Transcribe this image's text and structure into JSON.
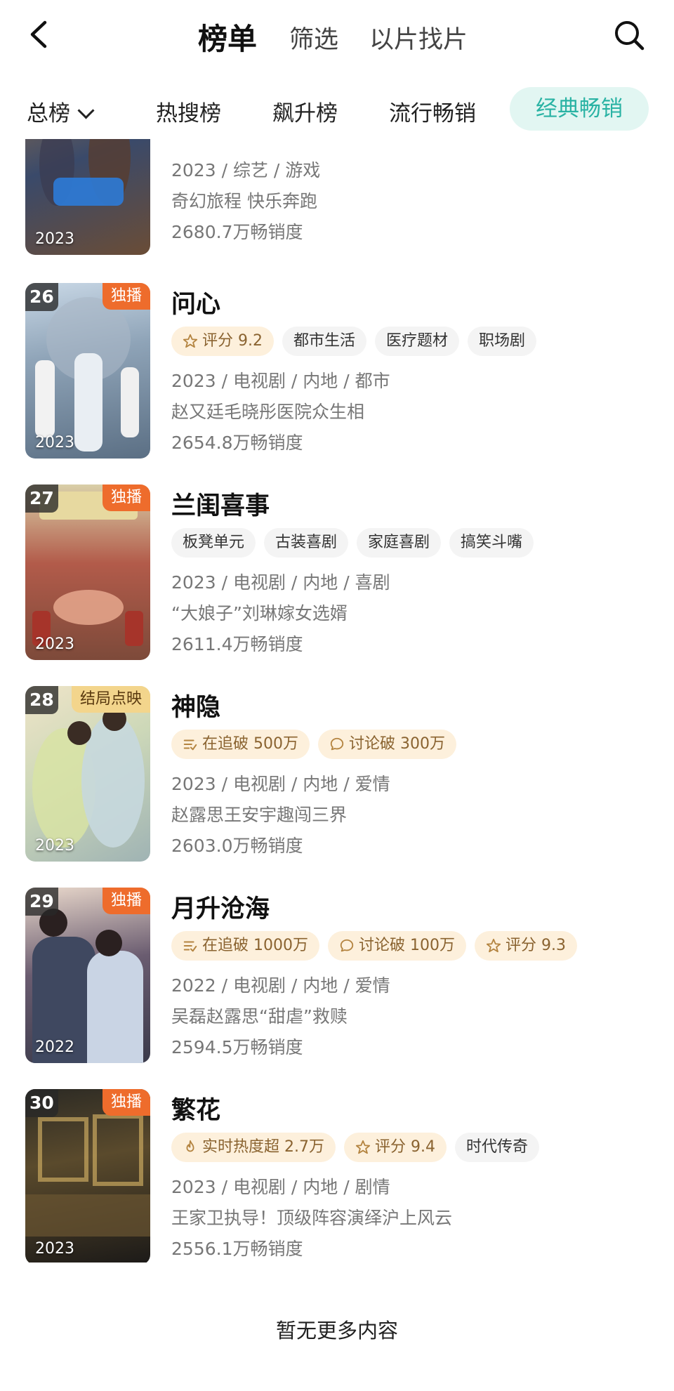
{
  "header": {
    "title": "榜单",
    "tabs": [
      "筛选",
      "以片找片"
    ]
  },
  "subtabs": {
    "dropdown": "总榜",
    "items": [
      "热搜榜",
      "飙升榜",
      "流行畅销"
    ],
    "active": "经典畅销"
  },
  "colors": {
    "accent": "#2ab3a4",
    "accent_bg": "#e2f6f2",
    "exclusive_badge": "#ee6c2c",
    "warm_tag_bg": "#fdf0dc"
  },
  "items": [
    {
      "year": "2023",
      "meta": "2023 / 综艺 / 游戏",
      "desc": "奇幻旅程 快乐奔跑",
      "heat": "2680.7万畅销度"
    },
    {
      "rank": "26",
      "badge": "独播",
      "name": "问心",
      "year": "2023",
      "tags": [
        {
          "icon": "star-icon",
          "text": "评分 9.2",
          "warm": true
        },
        {
          "text": "都市生活"
        },
        {
          "text": "医疗题材"
        },
        {
          "text": "职场剧"
        }
      ],
      "meta": "2023 / 电视剧 / 内地 / 都市",
      "desc": "赵又廷毛晓彤医院众生相",
      "heat": "2654.8万畅销度"
    },
    {
      "rank": "27",
      "badge": "独播",
      "name": "兰闺喜事",
      "year": "2023",
      "tags": [
        {
          "text": "板凳单元"
        },
        {
          "text": "古装喜剧"
        },
        {
          "text": "家庭喜剧"
        },
        {
          "text": "搞笑斗嘴"
        }
      ],
      "meta": "2023 / 电视剧 / 内地 / 喜剧",
      "desc": "“大娘子”刘琳嫁女选婿",
      "heat": "2611.4万畅销度"
    },
    {
      "rank": "28",
      "badge": "结局点映",
      "name": "神隐",
      "year": "2023",
      "tags": [
        {
          "icon": "list-icon",
          "text": "在追破 500万",
          "warm": true
        },
        {
          "icon": "comment-icon",
          "text": "讨论破 300万",
          "warm": true
        }
      ],
      "meta": "2023 / 电视剧 / 内地 / 爱情",
      "desc": "赵露思王安宇趣闯三界",
      "heat": "2603.0万畅销度"
    },
    {
      "rank": "29",
      "badge": "独播",
      "name": "月升沧海",
      "year": "2022",
      "tags": [
        {
          "icon": "list-icon",
          "text": "在追破 1000万",
          "warm": true
        },
        {
          "icon": "comment-icon",
          "text": "讨论破 100万",
          "warm": true
        },
        {
          "icon": "star-icon",
          "text": "评分 9.3",
          "warm": true
        }
      ],
      "meta": "2022 / 电视剧 / 内地 / 爱情",
      "desc": "吴磊赵露思“甜虐”救赎",
      "heat": "2594.5万畅销度"
    },
    {
      "rank": "30",
      "badge": "独播",
      "name": "繁花",
      "year": "2023",
      "tags": [
        {
          "icon": "fire-icon",
          "text": "实时热度超 2.7万",
          "warm": true
        },
        {
          "icon": "star-icon",
          "text": "评分 9.4",
          "warm": true
        },
        {
          "text": "时代传奇"
        }
      ],
      "meta": "2023 / 电视剧 / 内地 / 剧情",
      "desc": "王家卫执导！顶级阵容演绎沪上风云",
      "heat": "2556.1万畅销度"
    }
  ],
  "footer": {
    "no_more": "暂无更多内容"
  }
}
